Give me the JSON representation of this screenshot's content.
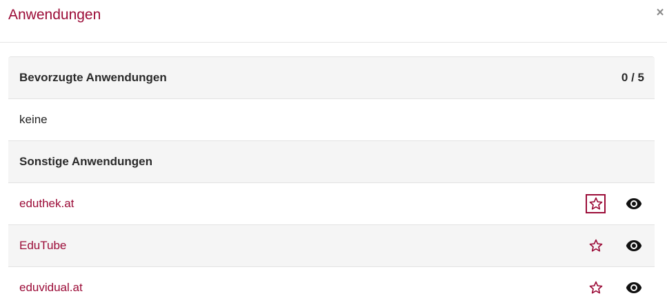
{
  "dialog": {
    "title": "Anwendungen",
    "close_label": "×"
  },
  "favorites": {
    "heading": "Bevorzugte Anwendungen",
    "count": "0 / 5",
    "empty_text": "keine"
  },
  "others": {
    "heading": "Sonstige Anwendungen",
    "items": [
      {
        "label": "eduthek.at",
        "star_icon": "star-outline-icon",
        "view_icon": "eye-icon"
      },
      {
        "label": "EduTube",
        "star_icon": "star-outline-icon",
        "view_icon": "eye-icon"
      },
      {
        "label": "eduvidual.at",
        "star_icon": "star-outline-icon",
        "view_icon": "eye-icon"
      }
    ]
  },
  "colors": {
    "accent": "#9b0b37",
    "row_shade": "#f5f5f5",
    "divider": "#e2e2e2"
  }
}
